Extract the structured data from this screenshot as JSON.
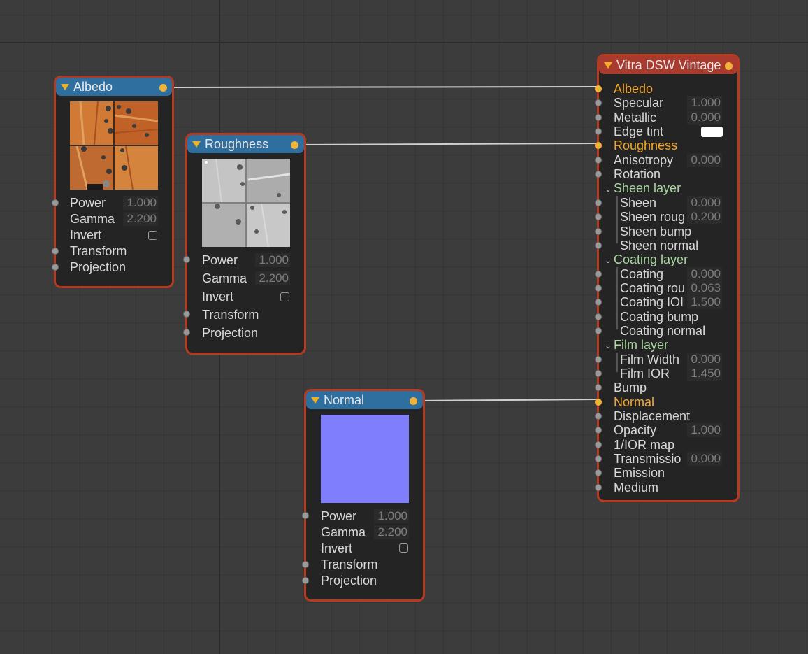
{
  "tex_nodes": [
    {
      "title": "Albedo",
      "texture": "wood-diffuse-thumbnail",
      "power_label": "Power",
      "power": "1.000",
      "gamma_label": "Gamma",
      "gamma": "2.200",
      "invert_label": "Invert",
      "transform_label": "Transform",
      "projection_label": "Projection"
    },
    {
      "title": "Roughness",
      "texture": "roughness-map-thumbnail",
      "power_label": "Power",
      "power": "1.000",
      "gamma_label": "Gamma",
      "gamma": "2.200",
      "invert_label": "Invert",
      "transform_label": "Transform",
      "projection_label": "Projection"
    },
    {
      "title": "Normal",
      "texture": "normal-map-thumbnail",
      "power_label": "Power",
      "power": "1.000",
      "gamma_label": "Gamma",
      "gamma": "2.200",
      "invert_label": "Invert",
      "transform_label": "Transform",
      "projection_label": "Projection"
    }
  ],
  "material": {
    "title": "Vitra DSW Vintage",
    "rows": [
      {
        "label": "Albedo",
        "connected": true
      },
      {
        "label": "Specular",
        "value": "1.000"
      },
      {
        "label": "Metallic",
        "value": "0.000"
      },
      {
        "label": "Edge tint",
        "swatch": "#ffffff"
      },
      {
        "label": "Roughness",
        "connected": true
      },
      {
        "label": "Anisotropy",
        "value": "0.000"
      },
      {
        "label": "Rotation"
      },
      {
        "label": "Sheen layer",
        "group": true
      },
      {
        "label": "Sheen",
        "value": "0.000"
      },
      {
        "label": "Sheen roug",
        "value": "0.200"
      },
      {
        "label": "Sheen bump"
      },
      {
        "label": "Sheen normal"
      },
      {
        "label": "Coating layer",
        "group": true
      },
      {
        "label": "Coating",
        "value": "0.000"
      },
      {
        "label": "Coating rou",
        "value": "0.063"
      },
      {
        "label": "Coating IOI",
        "value": "1.500"
      },
      {
        "label": "Coating bump"
      },
      {
        "label": "Coating normal"
      },
      {
        "label": "Film layer",
        "group": true
      },
      {
        "label": "Film Width",
        "value": "0.000"
      },
      {
        "label": "Film IOR",
        "value": "1.450"
      },
      {
        "label": "Bump"
      },
      {
        "label": "Normal",
        "connected": true
      },
      {
        "label": "Displacement"
      },
      {
        "label": "Opacity",
        "value": "1.000"
      },
      {
        "label": "1/IOR map"
      },
      {
        "label": "Transmissio",
        "value": "0.000"
      },
      {
        "label": "Emission"
      },
      {
        "label": "Medium"
      }
    ]
  },
  "colors": {
    "canvas": "#3c3c3c",
    "node_border": "#b8391e",
    "texture_header": "#2f6f9f",
    "material_header": "#a83b2e",
    "connected_label": "#f0a830",
    "group_label": "#a9d6a0",
    "wire": "#d0d0d0"
  }
}
